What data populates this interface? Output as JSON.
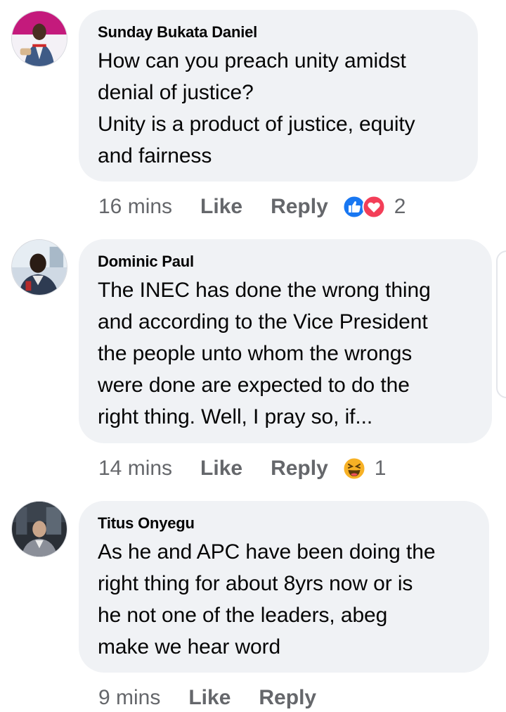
{
  "comments": [
    {
      "author": "Sunday Bukata Daniel",
      "text": "How can you preach unity amidst\ndenial of justice?\nUnity is a product of justice, equity\nand fairness",
      "time": "16 mins",
      "like_label": "Like",
      "reply_label": "Reply",
      "reactions": [
        "like-icon",
        "love-icon"
      ],
      "reaction_count": "2",
      "avatar_icon": "profile-photo"
    },
    {
      "author": "Dominic Paul",
      "text": "The INEC has done the wrong thing\nand according to the Vice President\nthe people unto whom the wrongs\nwere done are expected to do the\nright thing. Well, I pray so, if...",
      "time": "14 mins",
      "like_label": "Like",
      "reply_label": "Reply",
      "reactions": [
        "haha-icon"
      ],
      "reaction_count": "1",
      "avatar_icon": "profile-photo"
    },
    {
      "author": "Titus Onyegu",
      "text": "As he and APC have been doing the\nright thing for about 8yrs now or is\nhe not one of the leaders, abeg\nmake we hear word",
      "time": "9 mins",
      "like_label": "Like",
      "reply_label": "Reply",
      "avatar_icon": "profile-photo"
    }
  ],
  "colors": {
    "bubble": "#f0f2f5",
    "meta_text": "#65676b",
    "like_blue": "#1877f2",
    "love_red": "#f33e58",
    "haha_yellow": "#f7b125"
  }
}
